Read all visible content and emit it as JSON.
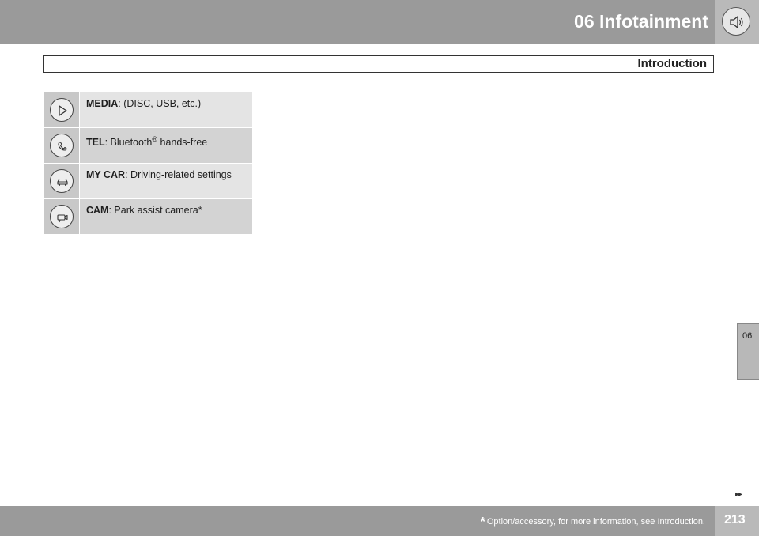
{
  "header": {
    "chapter_title": "06  Infotainment",
    "icon": "speaker-icon"
  },
  "section": {
    "title": "Introduction"
  },
  "menu": {
    "items": [
      {
        "label": "MEDIA",
        "description": ": (DISC, USB, etc.)",
        "icon": "play-icon"
      },
      {
        "label": "TEL",
        "description_before": ": Bluetooth",
        "sup": "®",
        "description_after": " hands-free",
        "icon": "phone-icon"
      },
      {
        "label": "MY CAR",
        "description": ": Driving-related settings",
        "icon": "car-icon"
      },
      {
        "label": "CAM",
        "description": ": Park assist camera*",
        "icon": "camera-icon"
      }
    ]
  },
  "side_tab": {
    "label": "06"
  },
  "navigation": {
    "next_arrows": "▸▸"
  },
  "footer": {
    "star": "*",
    "footnote": "Option/accessory, for more information, see Introduction.",
    "page_number": "213"
  },
  "colors": {
    "band": "#9a9a9a",
    "tab": "#b9b9b9",
    "row_light": "#e4e4e4",
    "row_dark": "#d3d3d3",
    "icon_cell": "#c8c8c8"
  }
}
